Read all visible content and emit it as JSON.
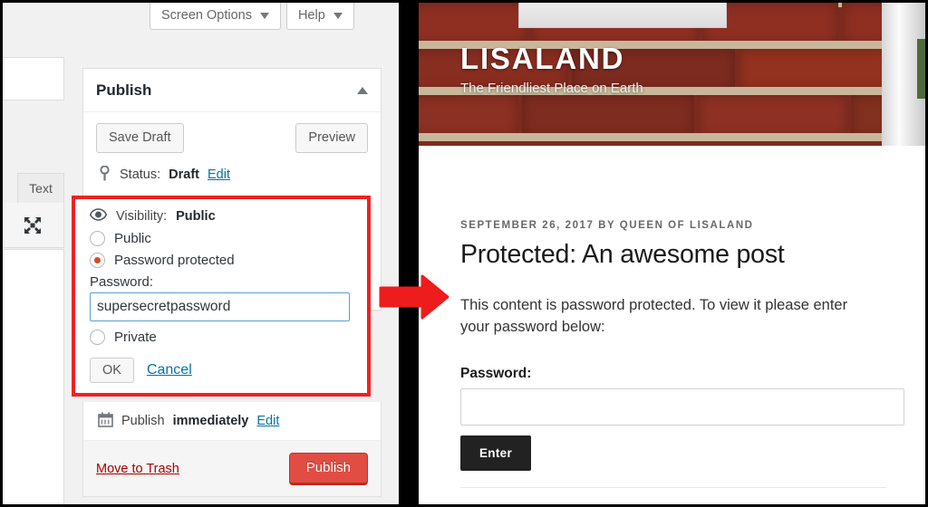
{
  "admin": {
    "top_buttons": [
      {
        "label": "Screen Options",
        "icon": "chevron-down-icon"
      },
      {
        "label": "Help",
        "icon": "chevron-down-icon"
      }
    ],
    "editor_tab": "Text",
    "fullscreen_icon": "fullscreen-icon",
    "publish_box": {
      "title": "Publish",
      "collapse_icon": "chevron-up-icon",
      "save_draft": "Save Draft",
      "preview": "Preview",
      "status_icon": "pin-icon",
      "status_prefix": "Status:",
      "status_value": "Draft",
      "status_edit": "Edit",
      "visibility": {
        "icon": "eye-icon",
        "prefix": "Visibility:",
        "value": "Public",
        "options": [
          {
            "label": "Public",
            "selected": false
          },
          {
            "label": "Password protected",
            "selected": true
          },
          {
            "label": "Private",
            "selected": false
          }
        ],
        "password_label": "Password:",
        "password_value": "supersecretpassword",
        "ok": "OK",
        "cancel": "Cancel",
        "highlight_color": "#ee2222",
        "radio_accent": "#d54e21"
      },
      "schedule_icon": "calendar-icon",
      "schedule_prefix": "Publish",
      "schedule_value": "immediately",
      "schedule_edit": "Edit",
      "move_to_trash": "Move to Trash",
      "publish_button": "Publish",
      "publish_color": "#e14d43",
      "trash_color": "#a00000",
      "link_color": "#0073aa"
    }
  },
  "site": {
    "title": "LISALAND",
    "tagline": "The Friendliest Place on Earth",
    "post": {
      "meta": "SEPTEMBER 26, 2017 BY QUEEN OF LISALAND",
      "title": "Protected: An awesome post",
      "body": "This content is password protected. To view it please enter your password below:"
    },
    "password_form": {
      "label": "Password:",
      "value": "",
      "placeholder": "",
      "submit": "Enter",
      "submit_color": "#222222"
    }
  },
  "annotation": {
    "arrow_icon": "right-arrow-annotation",
    "arrow_color": "#ee1c1c"
  }
}
